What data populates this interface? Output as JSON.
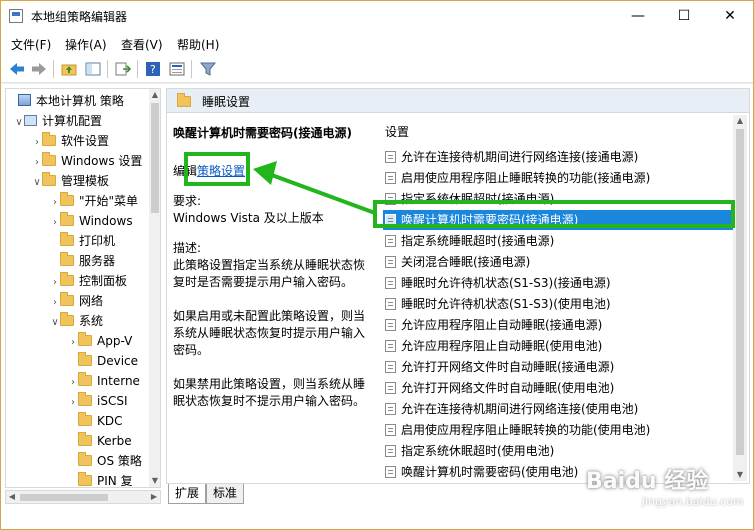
{
  "window": {
    "title": "本地组策略编辑器",
    "minimize": "—",
    "maximize": "☐",
    "close": "✕"
  },
  "menu": {
    "file": "文件(F)",
    "action": "操作(A)",
    "view": "查看(V)",
    "help": "帮助(H)"
  },
  "toolbar": {
    "icons": [
      "back-arrow-icon",
      "forward-arrow-icon",
      "up-folder-icon",
      "show-hide-tree-icon",
      "export-list-icon",
      "help-icon",
      "properties-icon",
      "filter-icon"
    ]
  },
  "tree": {
    "items": [
      {
        "label": "本地计算机 策略",
        "level": 0,
        "expander": "",
        "icon": "policy"
      },
      {
        "label": "计算机配置",
        "level": 1,
        "expander": "∨",
        "icon": "pc"
      },
      {
        "label": "软件设置",
        "level": 2,
        "expander": "›",
        "icon": "folder"
      },
      {
        "label": "Windows 设置",
        "level": 2,
        "expander": "›",
        "icon": "folder"
      },
      {
        "label": "管理模板",
        "level": 2,
        "expander": "∨",
        "icon": "folder"
      },
      {
        "label": "\"开始\"菜单",
        "level": 3,
        "expander": "›",
        "icon": "folder"
      },
      {
        "label": "Windows",
        "level": 3,
        "expander": "›",
        "icon": "folder"
      },
      {
        "label": "打印机",
        "level": 3,
        "expander": "",
        "icon": "folder"
      },
      {
        "label": "服务器",
        "level": 3,
        "expander": "",
        "icon": "folder"
      },
      {
        "label": "控制面板",
        "level": 3,
        "expander": "›",
        "icon": "folder"
      },
      {
        "label": "网络",
        "level": 3,
        "expander": "›",
        "icon": "folder"
      },
      {
        "label": "系统",
        "level": 3,
        "expander": "∨",
        "icon": "folder"
      },
      {
        "label": "App-V",
        "level": 4,
        "expander": "›",
        "icon": "folder"
      },
      {
        "label": "Device",
        "level": 4,
        "expander": "",
        "icon": "folder"
      },
      {
        "label": "Interne",
        "level": 4,
        "expander": "›",
        "icon": "folder"
      },
      {
        "label": "iSCSI",
        "level": 4,
        "expander": "›",
        "icon": "folder"
      },
      {
        "label": "KDC",
        "level": 4,
        "expander": "",
        "icon": "folder"
      },
      {
        "label": "Kerbe",
        "level": 4,
        "expander": "",
        "icon": "folder"
      },
      {
        "label": "OS 策略",
        "level": 4,
        "expander": "",
        "icon": "folder"
      },
      {
        "label": "PIN 复",
        "level": 4,
        "expander": "",
        "icon": "folder"
      }
    ]
  },
  "right": {
    "header": "睡眠设置",
    "policy_title": "唤醒计算机时需要密码(接通电源)",
    "edit_prefix": "编辑",
    "edit_link": "策略设置",
    "requirements_label": "要求:",
    "requirements_value": "Windows Vista 及以上版本",
    "description_label": "描述:",
    "description_1": "此策略设置指定当系统从睡眠状态恢复时是否需要提示用户输入密码。",
    "description_2": "如果启用或未配置此策略设置，则当系统从睡眠状态恢复时提示用户输入密码。",
    "description_3": "如果禁用此策略设置，则当系统从睡眠状态恢复时不提示用户输入密码。",
    "list_header": "设置",
    "settings": [
      "允许在连接待机期间进行网络连接(接通电源)",
      "启用使应用程序阻止睡眠转换的功能(接通电源)",
      "指定系统休眠超时(接通电源)",
      "唤醒计算机时需要密码(接通电源)",
      "指定系统睡眠超时(接通电源)",
      "关闭混合睡眠(接通电源)",
      "睡眠时允许待机状态(S1-S3)(接通电源)",
      "睡眠时允许待机状态(S1-S3)(使用电池)",
      "允许应用程序阻止自动睡眠(接通电源)",
      "允许应用程序阻止自动睡眠(使用电池)",
      "允许打开网络文件时自动睡眠(接通电源)",
      "允许打开网络文件时自动睡眠(使用电池)",
      "允许在连接待机期间进行网络连接(使用电池)",
      "启用使应用程序阻止睡眠转换的功能(使用电池)",
      "指定系统休眠超时(使用电池)",
      "唤醒计算机时需要密码(使用电池)"
    ],
    "selected_index": 3
  },
  "tabs": {
    "extended": "扩展",
    "standard": "标准"
  },
  "watermark": {
    "brand": "Baidu 经验",
    "sub": "jingyan.baidu.com"
  },
  "colors": {
    "selection": "#1a86dc",
    "annotation_green": "#22b51c",
    "link": "#0a5bc4"
  }
}
